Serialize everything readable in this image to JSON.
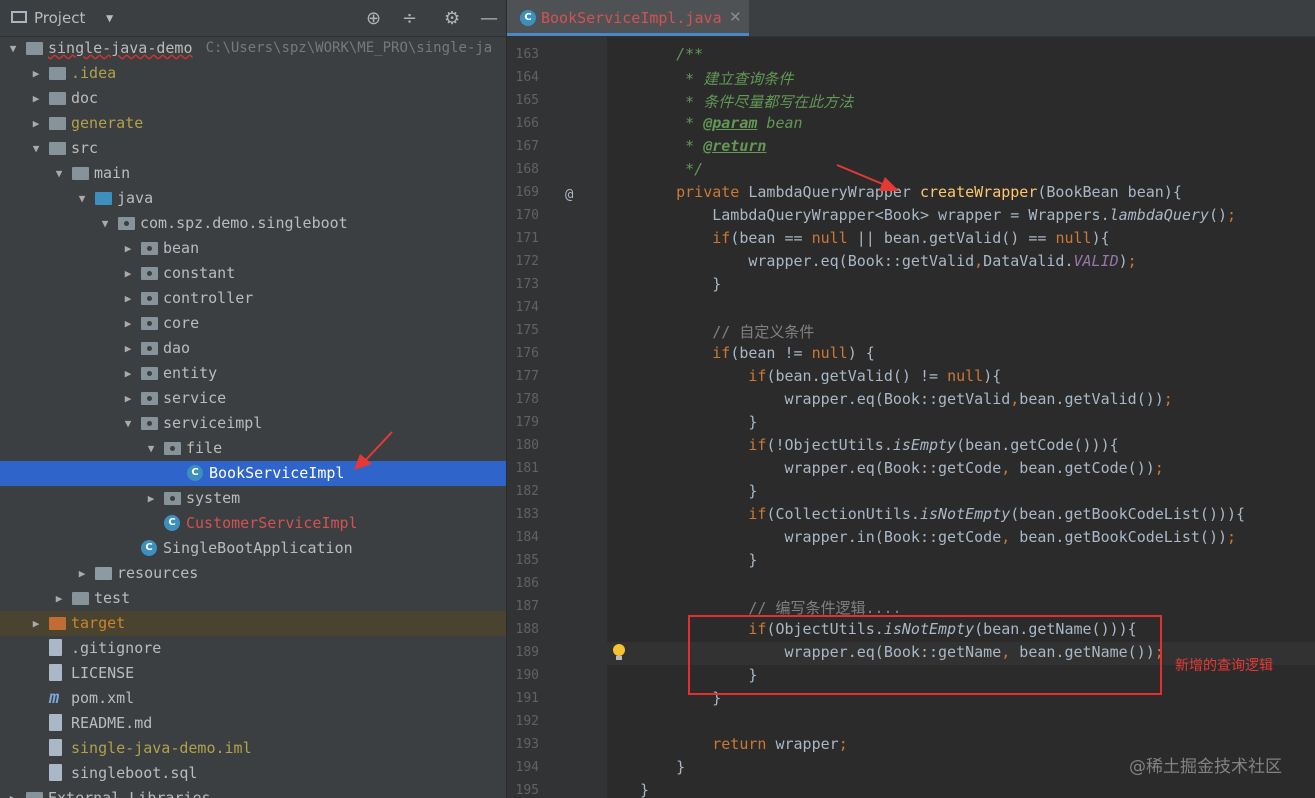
{
  "project": {
    "title": "Project",
    "tree": [
      {
        "label": "single-java-demo",
        "path": "C:\\Users\\spz\\WORK\\ME_PRO\\single-ja",
        "depth": 0,
        "open": true,
        "icon": "module-folder-icon",
        "style": "under"
      },
      {
        "label": ".idea",
        "depth": 1,
        "open": false,
        "icon": "folder-icon",
        "style": "yellow"
      },
      {
        "label": "doc",
        "depth": 1,
        "open": false,
        "icon": "folder-icon"
      },
      {
        "label": "generate",
        "depth": 1,
        "open": false,
        "icon": "folder-icon",
        "style": "yellow"
      },
      {
        "label": "src",
        "depth": 1,
        "open": true,
        "icon": "folder-icon"
      },
      {
        "label": "main",
        "depth": 2,
        "open": true,
        "icon": "folder-icon"
      },
      {
        "label": "java",
        "depth": 3,
        "open": true,
        "icon": "source-folder-icon"
      },
      {
        "label": "com.spz.demo.singleboot",
        "depth": 4,
        "open": true,
        "icon": "package-icon"
      },
      {
        "label": "bean",
        "depth": 5,
        "open": false,
        "icon": "package-icon"
      },
      {
        "label": "constant",
        "depth": 5,
        "open": false,
        "icon": "package-icon"
      },
      {
        "label": "controller",
        "depth": 5,
        "open": false,
        "icon": "package-icon"
      },
      {
        "label": "core",
        "depth": 5,
        "open": false,
        "icon": "package-icon"
      },
      {
        "label": "dao",
        "depth": 5,
        "open": false,
        "icon": "package-icon"
      },
      {
        "label": "entity",
        "depth": 5,
        "open": false,
        "icon": "package-icon"
      },
      {
        "label": "service",
        "depth": 5,
        "open": false,
        "icon": "package-icon"
      },
      {
        "label": "serviceimpl",
        "depth": 5,
        "open": true,
        "icon": "package-icon"
      },
      {
        "label": "file",
        "depth": 6,
        "open": true,
        "icon": "package-icon"
      },
      {
        "label": "BookServiceImpl",
        "depth": 7,
        "icon": "class-icon",
        "selected": true
      },
      {
        "label": "system",
        "depth": 6,
        "open": false,
        "icon": "package-icon"
      },
      {
        "label": "CustomerServiceImpl",
        "depth": 6,
        "icon": "class-icon",
        "style": "red",
        "leaf": true
      },
      {
        "label": "SingleBootApplication",
        "depth": 5,
        "icon": "spring-class-icon",
        "leaf": true
      },
      {
        "label": "resources",
        "depth": 3,
        "open": false,
        "icon": "resources-folder-icon"
      },
      {
        "label": "test",
        "depth": 2,
        "open": false,
        "icon": "folder-icon"
      },
      {
        "label": "target",
        "depth": 1,
        "open": false,
        "icon": "excluded-folder-icon",
        "style": "orange",
        "excluded": true
      },
      {
        "label": ".gitignore",
        "depth": 1,
        "icon": "gitignore-file-icon",
        "leaf": true
      },
      {
        "label": "LICENSE",
        "depth": 1,
        "icon": "text-file-icon",
        "leaf": true
      },
      {
        "label": "pom.xml",
        "depth": 1,
        "icon": "maven-icon",
        "leaf": true
      },
      {
        "label": "README.md",
        "depth": 1,
        "icon": "markdown-file-icon",
        "leaf": true
      },
      {
        "label": "single-java-demo.iml",
        "depth": 1,
        "icon": "iml-file-icon",
        "style": "yellow",
        "leaf": true
      },
      {
        "label": "singleboot.sql",
        "depth": 1,
        "icon": "sql-file-icon",
        "leaf": true
      },
      {
        "label": "External Libraries",
        "depth": 0,
        "open": false,
        "icon": "library-icon"
      }
    ]
  },
  "editor": {
    "tab_label": "BookServiceImpl.java",
    "first_line": 163,
    "current_line": 189,
    "lines": [
      {
        "n": "163",
        "html": "    <span class='cm'>/**</span>"
      },
      {
        "n": "164",
        "html": "    <span class='cm'> * 建立查询条件</span>"
      },
      {
        "n": "165",
        "html": "    <span class='cm'> * 条件尽量都写在此方法</span>"
      },
      {
        "n": "166",
        "html": "    <span class='cm'> * </span><span class='tag'>@param</span><span class='cm'> bean</span>"
      },
      {
        "n": "167",
        "html": "    <span class='cm'> * </span><span class='tag'>@return</span>"
      },
      {
        "n": "168",
        "html": "    <span class='cm'> */</span>"
      },
      {
        "n": "169",
        "html": "    <span class='kw'>private</span> LambdaQueryWrapper <span class='fn'>createWrapper</span>(BookBean bean){"
      },
      {
        "n": "170",
        "html": "        LambdaQueryWrapper&lt;Book&gt; wrapper = Wrappers.<span class='it'>lambdaQuery</span>()<span class='kw'>;</span>"
      },
      {
        "n": "171",
        "html": "        <span class='kw'>if</span>(bean == <span class='kw'>null</span> || bean.getValid() == <span class='kw'>null</span>){"
      },
      {
        "n": "172",
        "html": "            wrapper.eq(Book::getValid<span class='kw'>,</span>DataValid.<span class='const'>VALID</span>)<span class='kw'>;</span>"
      },
      {
        "n": "173",
        "html": "        }"
      },
      {
        "n": "174",
        "html": ""
      },
      {
        "n": "175",
        "html": "        <span class='cmt'>// 自定义条件</span>"
      },
      {
        "n": "176",
        "html": "        <span class='kw'>if</span>(bean != <span class='kw'>null</span>) {"
      },
      {
        "n": "177",
        "html": "            <span class='kw'>if</span>(bean.getValid() != <span class='kw'>null</span>){"
      },
      {
        "n": "178",
        "html": "                wrapper.eq(Book::getValid<span class='kw'>,</span>bean.getValid())<span class='kw'>;</span>"
      },
      {
        "n": "179",
        "html": "            }"
      },
      {
        "n": "180",
        "html": "            <span class='kw'>if</span>(!ObjectUtils.<span class='it'>isEmpty</span>(bean.getCode())){"
      },
      {
        "n": "181",
        "html": "                wrapper.eq(Book::getCode<span class='kw'>,</span> bean.getCode())<span class='kw'>;</span>"
      },
      {
        "n": "182",
        "html": "            }"
      },
      {
        "n": "183",
        "html": "            <span class='kw'>if</span>(CollectionUtils.<span class='it'>isNotEmpty</span>(bean.getBookCodeList())){"
      },
      {
        "n": "184",
        "html": "                wrapper.in(Book::getCode<span class='kw'>,</span> bean.getBookCodeList())<span class='kw'>;</span>"
      },
      {
        "n": "185",
        "html": "            }"
      },
      {
        "n": "186",
        "html": ""
      },
      {
        "n": "187",
        "html": "            <span class='cmt'>// 编写条件逻辑....</span>"
      },
      {
        "n": "188",
        "html": "            <span class='kw'>if</span>(ObjectUtils.<span class='it'>isNotEmpty</span>(bean.getName())){"
      },
      {
        "n": "189",
        "html": "                wrapper.eq(Book::getName<span class='kw'>,</span> bean.getName())<span class='kw'>;</span>"
      },
      {
        "n": "190",
        "html": "            }"
      },
      {
        "n": "191",
        "html": "        }"
      },
      {
        "n": "192",
        "html": ""
      },
      {
        "n": "193",
        "html": "        <span class='kw'>return</span> wrapper<span class='kw'>;</span>"
      },
      {
        "n": "194",
        "html": "    }"
      },
      {
        "n": "195",
        "html": "}"
      }
    ],
    "annotation_note": "新增的查询逻辑",
    "watermark": "@稀土掘金技术社区",
    "override_marker": "@"
  },
  "colors": {
    "accent": "#2f65ca",
    "annotation": "#e03030",
    "keyword": "#cc7832",
    "doc_comment": "#629755"
  }
}
